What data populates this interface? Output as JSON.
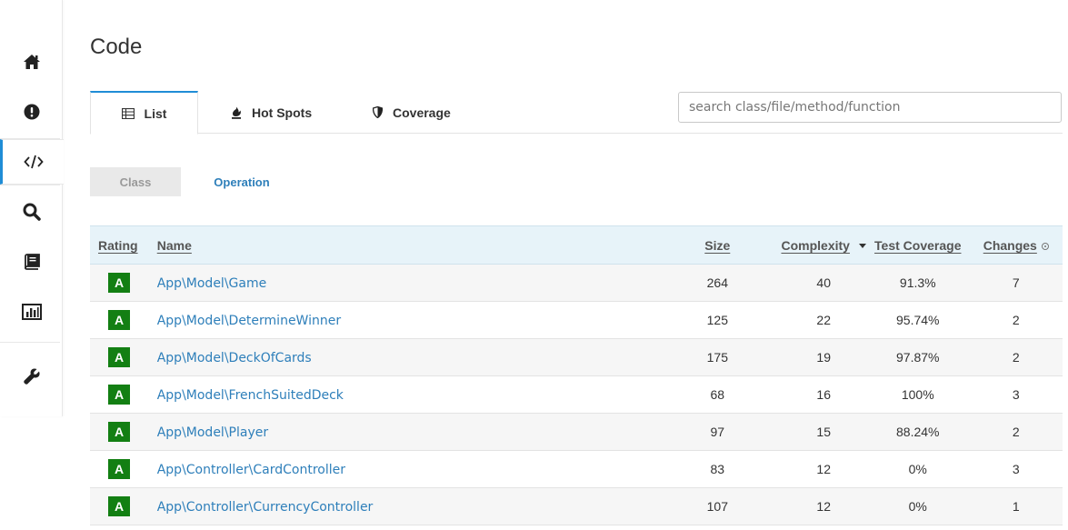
{
  "page": {
    "title": "Code"
  },
  "sidebar": {
    "items": [
      {
        "icon": "home-icon"
      },
      {
        "icon": "exclamation-circle-icon"
      },
      {
        "icon": "code-icon",
        "active": true
      },
      {
        "icon": "search-icon"
      },
      {
        "icon": "book-icon"
      },
      {
        "icon": "bar-chart-icon"
      },
      {
        "icon": "wrench-icon"
      }
    ]
  },
  "tabs": [
    {
      "label": "List",
      "icon": "table-icon",
      "active": true
    },
    {
      "label": "Hot Spots",
      "icon": "fire-icon"
    },
    {
      "label": "Coverage",
      "icon": "shield-icon"
    }
  ],
  "search": {
    "placeholder": "search class/file/method/function",
    "value": ""
  },
  "subtabs": [
    {
      "label": "Class",
      "selected": true
    },
    {
      "label": "Operation"
    }
  ],
  "table": {
    "headers": {
      "rating": "Rating",
      "name": "Name",
      "size": "Size",
      "complexity": "Complexity",
      "coverage": "Test Coverage",
      "changes": "Changes"
    },
    "sort_column": "complexity",
    "rows": [
      {
        "rating": "A",
        "name": "App\\Model\\Game",
        "size": "264",
        "complexity": "40",
        "coverage": "91.3%",
        "changes": "7"
      },
      {
        "rating": "A",
        "name": "App\\Model\\DetermineWinner",
        "size": "125",
        "complexity": "22",
        "coverage": "95.74%",
        "changes": "2"
      },
      {
        "rating": "A",
        "name": "App\\Model\\DeckOfCards",
        "size": "175",
        "complexity": "19",
        "coverage": "97.87%",
        "changes": "2"
      },
      {
        "rating": "A",
        "name": "App\\Model\\FrenchSuitedDeck",
        "size": "68",
        "complexity": "16",
        "coverage": "100%",
        "changes": "3"
      },
      {
        "rating": "A",
        "name": "App\\Model\\Player",
        "size": "97",
        "complexity": "15",
        "coverage": "88.24%",
        "changes": "2"
      },
      {
        "rating": "A",
        "name": "App\\Controller\\CardController",
        "size": "83",
        "complexity": "12",
        "coverage": "0%",
        "changes": "3"
      },
      {
        "rating": "A",
        "name": "App\\Controller\\CurrencyController",
        "size": "107",
        "complexity": "12",
        "coverage": "0%",
        "changes": "1"
      }
    ]
  },
  "colors": {
    "accent": "#1f8dd6",
    "link": "#2e7fba",
    "rating_a": "#137f13",
    "header_bg": "#e7f3f9"
  }
}
